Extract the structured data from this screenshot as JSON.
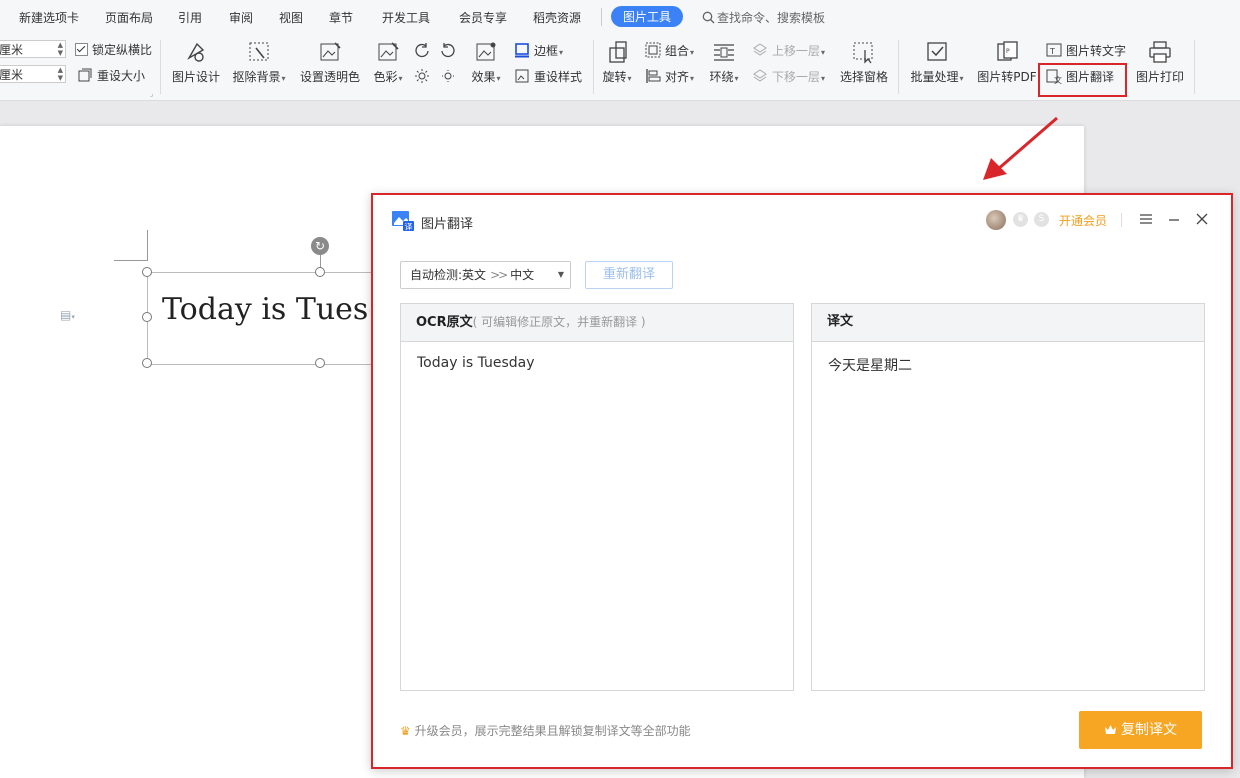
{
  "menu": {
    "tabs": [
      "新建选项卡",
      "页面布局",
      "引用",
      "审阅",
      "视图",
      "章节",
      "开发工具",
      "会员专享",
      "稻壳资源"
    ],
    "active_tab": "图片工具",
    "search_placeholder": "查找命令、搜索模板"
  },
  "ribbon": {
    "height_value": "厘米",
    "width_value": "厘米",
    "lock_ratio": "锁定纵横比",
    "reset_size": "重设大小",
    "picture_design": "图片设计",
    "remove_background": "抠除背景",
    "set_transparent": "设置透明色",
    "color": "色彩",
    "border": "边框",
    "effects": "效果",
    "reset_style": "重设样式",
    "rotate": "旋转",
    "group": "组合",
    "align": "对齐",
    "wrap": "环绕",
    "bring_forward": "上移一层",
    "send_backward": "下移一层",
    "selection_pane": "选择窗格",
    "batch_process": "批量处理",
    "to_pdf": "图片转PDF",
    "to_text": "图片转文字",
    "translate": "图片翻译",
    "print": "图片打印"
  },
  "document": {
    "text": "Today is Tuesday"
  },
  "dialog": {
    "title": "图片翻译",
    "vip_link": "开通会员",
    "language": {
      "prefix": "自动检测:",
      "source": "英文",
      "separator": ">>",
      "target": "中文"
    },
    "retranslate": "重新翻译",
    "ocr_panel": {
      "title": "OCR原文",
      "hint": "( 可编辑修正原文，并重新翻译 )",
      "content": "Today is Tuesday"
    },
    "result_panel": {
      "title": "译文",
      "content": "今天是星期二"
    },
    "upgrade_tip": "升级会员，展示完整结果且解锁复制译文等全部功能",
    "copy_button": "复制译文"
  },
  "colors": {
    "highlight_red": "#d8262b",
    "accent_blue": "#3b82f6",
    "vip_orange": "#f0a020",
    "copy_button": "#f6a623"
  }
}
